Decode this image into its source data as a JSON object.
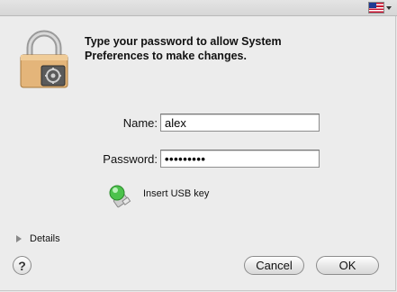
{
  "topbar": {
    "input_menu_icon": "us-flag-icon"
  },
  "dialog": {
    "icon": "lock-icon",
    "prompt_line1": "Type your password to allow System",
    "prompt_line2": "Preferences to make changes."
  },
  "form": {
    "name_label": "Name:",
    "name_value": "alex",
    "password_label": "Password:",
    "password_value": "•••••••••"
  },
  "usb": {
    "icon": "usb-key-icon",
    "label": "Insert USB key"
  },
  "details": {
    "label": "Details"
  },
  "buttons": {
    "help": "?",
    "cancel": "Cancel",
    "ok": "OK"
  }
}
